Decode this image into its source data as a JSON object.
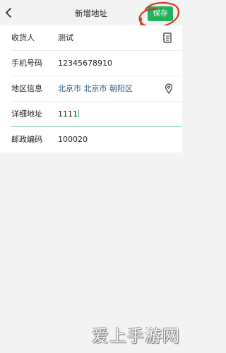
{
  "header": {
    "title": "新增地址",
    "save_label": "保存",
    "back_icon": "chevron-left-icon"
  },
  "form": {
    "rows": [
      {
        "label": "收货人",
        "value": "测试",
        "icon": "contact-book-icon"
      },
      {
        "label": "手机号码",
        "value": "12345678910"
      },
      {
        "label": "地区信息",
        "value": "北京市 北京市 朝阳区",
        "icon": "location-pin-icon"
      },
      {
        "label": "详细地址",
        "value": "1111"
      },
      {
        "label": "邮政编码",
        "value": "100020"
      }
    ]
  },
  "watermark": {
    "text": "爱上手游网"
  },
  "colors": {
    "accent": "#20b35a",
    "annotation": "#d8331f",
    "region_text": "#2c5588",
    "background": "#f3f3f3"
  }
}
